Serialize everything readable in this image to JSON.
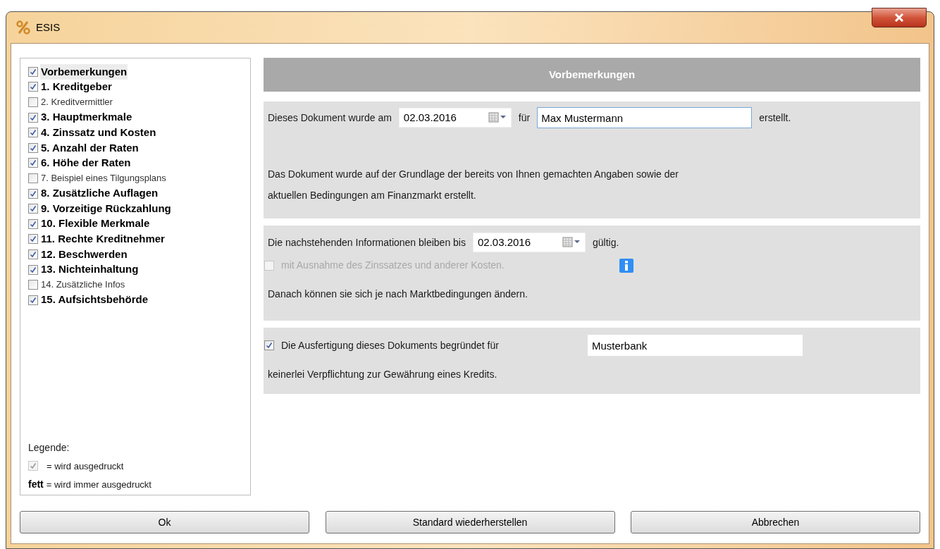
{
  "window": {
    "title": "ESIS"
  },
  "sections": [
    {
      "label": "Vorbemerkungen",
      "checked": true,
      "required": true,
      "selected": true
    },
    {
      "label": "1. Kreditgeber",
      "checked": true,
      "required": true,
      "selected": false
    },
    {
      "label": "2. Kreditvermittler",
      "checked": false,
      "required": false,
      "selected": false
    },
    {
      "label": "3. Hauptmerkmale",
      "checked": true,
      "required": true,
      "selected": false
    },
    {
      "label": "4. Zinssatz und Kosten",
      "checked": true,
      "required": true,
      "selected": false
    },
    {
      "label": "5. Anzahl der Raten",
      "checked": true,
      "required": true,
      "selected": false
    },
    {
      "label": "6. Höhe der Raten",
      "checked": true,
      "required": true,
      "selected": false
    },
    {
      "label": "7. Beispiel eines Tilgungsplans",
      "checked": false,
      "required": false,
      "selected": false
    },
    {
      "label": "8. Zusätzliche Auflagen",
      "checked": true,
      "required": true,
      "selected": false
    },
    {
      "label": "9. Vorzeitige Rückzahlung",
      "checked": true,
      "required": true,
      "selected": false
    },
    {
      "label": "10. Flexible Merkmale",
      "checked": true,
      "required": true,
      "selected": false
    },
    {
      "label": "11. Rechte Kreditnehmer",
      "checked": true,
      "required": true,
      "selected": false
    },
    {
      "label": "12. Beschwerden",
      "checked": true,
      "required": true,
      "selected": false
    },
    {
      "label": "13. Nichteinhaltung",
      "checked": true,
      "required": true,
      "selected": false
    },
    {
      "label": "14. Zusätzliche Infos",
      "checked": false,
      "required": false,
      "selected": false
    },
    {
      "label": "15. Aufsichtsbehörde",
      "checked": true,
      "required": true,
      "selected": false
    }
  ],
  "legend": {
    "title": "Legende:",
    "sample_checked": true,
    "checked_text": "= wird ausgedruckt",
    "bold_word": "fett",
    "bold_text": "= wird immer ausgedruckt"
  },
  "panel": {
    "title": "Vorbemerkungen",
    "block1": {
      "prefix": "Dieses Dokument wurde am",
      "date": "02.03.2016",
      "middle": "für",
      "name": "Max Mustermann",
      "suffix": "erstellt.",
      "paragraph_1": "Das Dokument wurde auf der Grundlage der bereits von Ihnen gemachten Angaben sowie der",
      "paragraph_2": "aktuellen Bedingungen am Finanzmarkt erstellt."
    },
    "block2": {
      "prefix": "Die nachstehenden Informationen bleiben bis",
      "date": "02.03.2016",
      "suffix": "gültig.",
      "exception": {
        "label": "mit Ausnahme des Zinssatzes und anderer Kosten.",
        "checked": false,
        "disabled": true
      },
      "note": "Danach können sie sich je nach Marktbedingungen ändern."
    },
    "block3": {
      "checkbox": {
        "label": "Die Ausfertigung dieses Dokuments begründet für",
        "checked": true
      },
      "lender": "Musterbank",
      "paragraph": "keinerlei Verpflichtung zur Gewährung eines Kredits."
    }
  },
  "buttons": [
    "Ok",
    "Standard wiederherstellen",
    "Abbrechen"
  ]
}
